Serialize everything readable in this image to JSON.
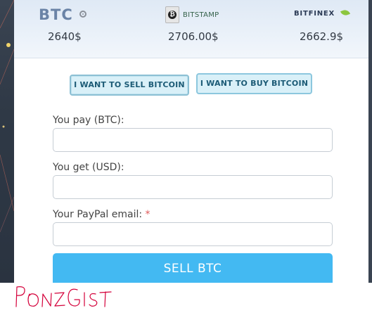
{
  "rates": {
    "btc": {
      "logo_text": "BTC",
      "value": "2640$"
    },
    "bitstamp": {
      "logo_text": "BITSTAMP",
      "value": "2706.00$"
    },
    "bitfinex": {
      "logo_text": "BITFINEX",
      "value": "2662.9$"
    }
  },
  "tabs": {
    "sell": "I WANT TO SELL BITCOIN",
    "buy": "I WANT TO BUY BITCOIN"
  },
  "form": {
    "pay_label": "You pay (BTC):",
    "get_label": "You get (USD):",
    "email_label": "Your PayPal email:",
    "required_mark": "*",
    "pay_value": "",
    "get_value": "",
    "email_value": "",
    "submit_label": "SELL BTC"
  },
  "signature": "PONZIGIST",
  "colors": {
    "accent": "#43b9f2",
    "tab_bg": "#d9f0f8",
    "tab_text": "#1c5b76",
    "signature": "#d4003a"
  }
}
